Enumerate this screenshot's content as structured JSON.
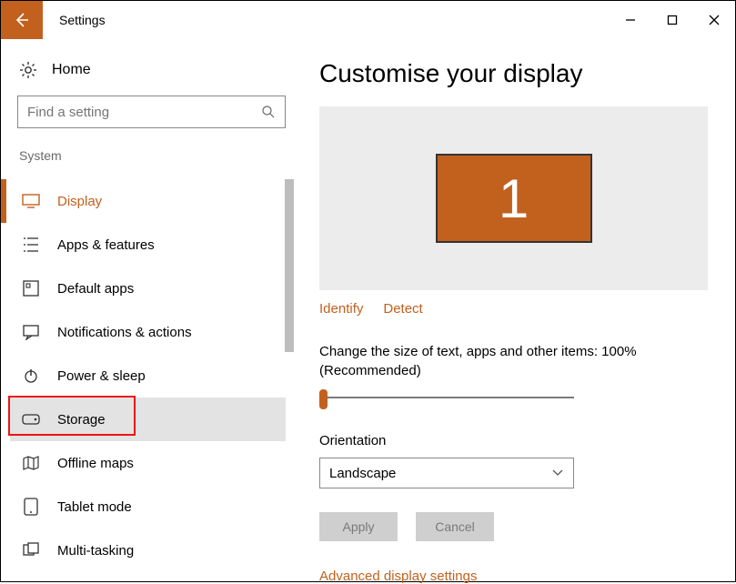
{
  "window": {
    "title": "Settings"
  },
  "sidebar": {
    "home": "Home",
    "search_placeholder": "Find a setting",
    "section": "System",
    "items": [
      {
        "label": "Display",
        "icon": "display-icon",
        "active": true
      },
      {
        "label": "Apps & features",
        "icon": "apps-icon"
      },
      {
        "label": "Default apps",
        "icon": "default-apps-icon"
      },
      {
        "label": "Notifications & actions",
        "icon": "notifications-icon"
      },
      {
        "label": "Power & sleep",
        "icon": "power-icon"
      },
      {
        "label": "Storage",
        "icon": "storage-icon",
        "hovered": true,
        "highlighted": true
      },
      {
        "label": "Offline maps",
        "icon": "maps-icon"
      },
      {
        "label": "Tablet mode",
        "icon": "tablet-icon"
      },
      {
        "label": "Multi-tasking",
        "icon": "multitasking-icon"
      }
    ]
  },
  "main": {
    "heading": "Customise your display",
    "monitor_number": "1",
    "identify": "Identify",
    "detect": "Detect",
    "scale_label": "Change the size of text, apps and other items: 100% (Recommended)",
    "orientation_label": "Orientation",
    "orientation_value": "Landscape",
    "apply": "Apply",
    "cancel": "Cancel",
    "advanced": "Advanced display settings"
  },
  "colors": {
    "accent": "#c2611e"
  }
}
